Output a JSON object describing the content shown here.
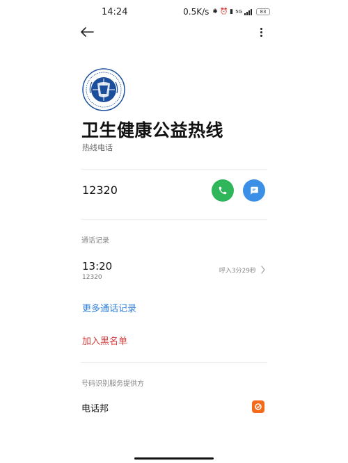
{
  "status_bar": {
    "time": "14:24",
    "net_speed": "0.5K/s",
    "network_type": "5G",
    "battery": "83"
  },
  "contact": {
    "name": "卫生健康公益热线",
    "subtitle": "热线电话",
    "number": "12320"
  },
  "call_history": {
    "section_label": "通话记录",
    "entries": [
      {
        "time": "13:20",
        "number": "12320",
        "detail": "呼入3分29秒"
      }
    ]
  },
  "actions": {
    "more_records": "更多通话记录",
    "add_blacklist": "加入黑名单"
  },
  "provider": {
    "section_label": "号码识别服务提供方",
    "name": "电话邦"
  },
  "colors": {
    "call_button": "#2fb65a",
    "message_button": "#3b8fe6",
    "link_blue": "#2f7fd9",
    "link_red": "#d33c3c",
    "provider_icon": "#f36a1d"
  },
  "icons": {
    "back": "arrow-left-icon",
    "more": "more-vertical-icon",
    "call": "phone-icon",
    "message": "message-icon",
    "chevron": "chevron-right-icon",
    "provider": "dianhuabang-logo-icon"
  }
}
